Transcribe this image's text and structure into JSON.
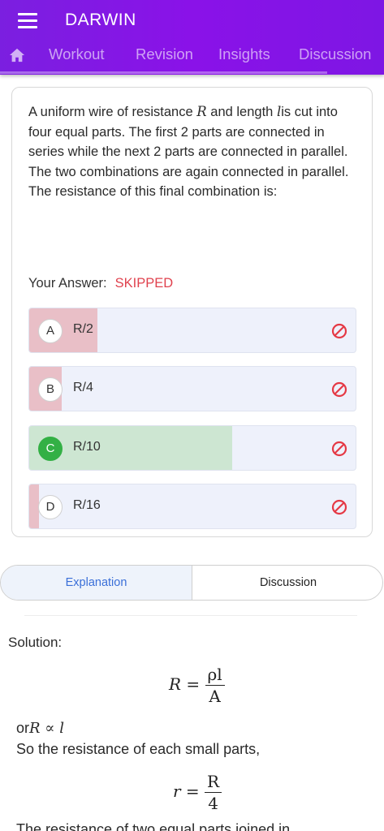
{
  "app": {
    "title": "DARWIN",
    "menu_icon": "hamburger-menu-icon",
    "home_icon": "home-icon"
  },
  "tabs": [
    {
      "label": "Workout"
    },
    {
      "label": "Revision"
    },
    {
      "label": "Insights"
    },
    {
      "label": "Discussion"
    }
  ],
  "question": {
    "text_before_R": "A uniform wire of resistance ",
    "var_R": "R",
    "text_mid": " and length ",
    "var_l": "l",
    "text_after": "is cut into four equal parts. The first 2 parts are connected in series while the next 2 parts are connected in parallel. The two combinations are again connected in parallel. The resistance of this final combination is:"
  },
  "your_answer": {
    "label": "Your Answer:",
    "value": "SKIPPED",
    "value_color": "#e0424e"
  },
  "options": [
    {
      "letter": "A",
      "label": "R/2",
      "response_fraction": 0.21,
      "status": "wrong",
      "icon": "ban-icon"
    },
    {
      "letter": "B",
      "label": "R/4",
      "response_fraction": 0.1,
      "status": "wrong",
      "icon": "ban-icon"
    },
    {
      "letter": "C",
      "label": "R/10",
      "response_fraction": 0.62,
      "status": "correct",
      "icon": "ban-icon"
    },
    {
      "letter": "D",
      "label": "R/16",
      "response_fraction": 0.03,
      "status": "wrong",
      "icon": "ban-icon"
    }
  ],
  "colors": {
    "accent": "#8a12e8",
    "wrong_fill": "#e9bfc7",
    "correct_fill": "#cde6d2",
    "correct_badge": "#33b045",
    "ban_icon": "#e53945",
    "explanation_tab": "#3a6fd8"
  },
  "explanation_tabs": [
    {
      "label": "Explanation",
      "active": true
    },
    {
      "label": "Discussion",
      "active": false
    }
  ],
  "solution": {
    "title": "Solution:",
    "eq1": {
      "lhs": "R",
      "num": "ρl",
      "den": "A"
    },
    "line1_prefix": "or",
    "line1_math": "R ∝ l",
    "line2": "So the resistance of each small parts,",
    "eq2": {
      "lhs": "r",
      "num": "R",
      "den": "4"
    },
    "line3_partial": "The resistance of two equal parts joined in"
  }
}
